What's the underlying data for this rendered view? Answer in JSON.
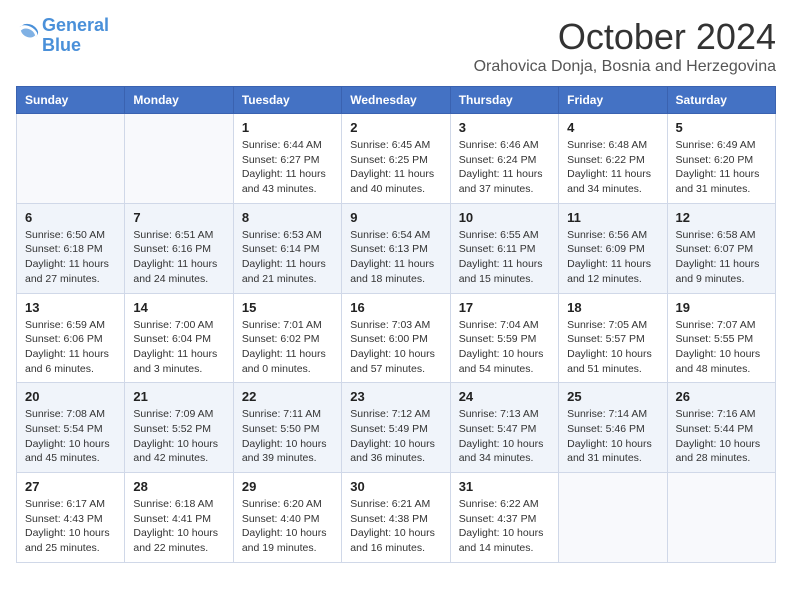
{
  "logo": {
    "line1": "General",
    "line2": "Blue"
  },
  "title": "October 2024",
  "subtitle": "Orahovica Donja, Bosnia and Herzegovina",
  "days_of_week": [
    "Sunday",
    "Monday",
    "Tuesday",
    "Wednesday",
    "Thursday",
    "Friday",
    "Saturday"
  ],
  "weeks": [
    [
      {
        "day": "",
        "sunrise": "",
        "sunset": "",
        "daylight": ""
      },
      {
        "day": "",
        "sunrise": "",
        "sunset": "",
        "daylight": ""
      },
      {
        "day": "1",
        "sunrise": "Sunrise: 6:44 AM",
        "sunset": "Sunset: 6:27 PM",
        "daylight": "Daylight: 11 hours and 43 minutes."
      },
      {
        "day": "2",
        "sunrise": "Sunrise: 6:45 AM",
        "sunset": "Sunset: 6:25 PM",
        "daylight": "Daylight: 11 hours and 40 minutes."
      },
      {
        "day": "3",
        "sunrise": "Sunrise: 6:46 AM",
        "sunset": "Sunset: 6:24 PM",
        "daylight": "Daylight: 11 hours and 37 minutes."
      },
      {
        "day": "4",
        "sunrise": "Sunrise: 6:48 AM",
        "sunset": "Sunset: 6:22 PM",
        "daylight": "Daylight: 11 hours and 34 minutes."
      },
      {
        "day": "5",
        "sunrise": "Sunrise: 6:49 AM",
        "sunset": "Sunset: 6:20 PM",
        "daylight": "Daylight: 11 hours and 31 minutes."
      }
    ],
    [
      {
        "day": "6",
        "sunrise": "Sunrise: 6:50 AM",
        "sunset": "Sunset: 6:18 PM",
        "daylight": "Daylight: 11 hours and 27 minutes."
      },
      {
        "day": "7",
        "sunrise": "Sunrise: 6:51 AM",
        "sunset": "Sunset: 6:16 PM",
        "daylight": "Daylight: 11 hours and 24 minutes."
      },
      {
        "day": "8",
        "sunrise": "Sunrise: 6:53 AM",
        "sunset": "Sunset: 6:14 PM",
        "daylight": "Daylight: 11 hours and 21 minutes."
      },
      {
        "day": "9",
        "sunrise": "Sunrise: 6:54 AM",
        "sunset": "Sunset: 6:13 PM",
        "daylight": "Daylight: 11 hours and 18 minutes."
      },
      {
        "day": "10",
        "sunrise": "Sunrise: 6:55 AM",
        "sunset": "Sunset: 6:11 PM",
        "daylight": "Daylight: 11 hours and 15 minutes."
      },
      {
        "day": "11",
        "sunrise": "Sunrise: 6:56 AM",
        "sunset": "Sunset: 6:09 PM",
        "daylight": "Daylight: 11 hours and 12 minutes."
      },
      {
        "day": "12",
        "sunrise": "Sunrise: 6:58 AM",
        "sunset": "Sunset: 6:07 PM",
        "daylight": "Daylight: 11 hours and 9 minutes."
      }
    ],
    [
      {
        "day": "13",
        "sunrise": "Sunrise: 6:59 AM",
        "sunset": "Sunset: 6:06 PM",
        "daylight": "Daylight: 11 hours and 6 minutes."
      },
      {
        "day": "14",
        "sunrise": "Sunrise: 7:00 AM",
        "sunset": "Sunset: 6:04 PM",
        "daylight": "Daylight: 11 hours and 3 minutes."
      },
      {
        "day": "15",
        "sunrise": "Sunrise: 7:01 AM",
        "sunset": "Sunset: 6:02 PM",
        "daylight": "Daylight: 11 hours and 0 minutes."
      },
      {
        "day": "16",
        "sunrise": "Sunrise: 7:03 AM",
        "sunset": "Sunset: 6:00 PM",
        "daylight": "Daylight: 10 hours and 57 minutes."
      },
      {
        "day": "17",
        "sunrise": "Sunrise: 7:04 AM",
        "sunset": "Sunset: 5:59 PM",
        "daylight": "Daylight: 10 hours and 54 minutes."
      },
      {
        "day": "18",
        "sunrise": "Sunrise: 7:05 AM",
        "sunset": "Sunset: 5:57 PM",
        "daylight": "Daylight: 10 hours and 51 minutes."
      },
      {
        "day": "19",
        "sunrise": "Sunrise: 7:07 AM",
        "sunset": "Sunset: 5:55 PM",
        "daylight": "Daylight: 10 hours and 48 minutes."
      }
    ],
    [
      {
        "day": "20",
        "sunrise": "Sunrise: 7:08 AM",
        "sunset": "Sunset: 5:54 PM",
        "daylight": "Daylight: 10 hours and 45 minutes."
      },
      {
        "day": "21",
        "sunrise": "Sunrise: 7:09 AM",
        "sunset": "Sunset: 5:52 PM",
        "daylight": "Daylight: 10 hours and 42 minutes."
      },
      {
        "day": "22",
        "sunrise": "Sunrise: 7:11 AM",
        "sunset": "Sunset: 5:50 PM",
        "daylight": "Daylight: 10 hours and 39 minutes."
      },
      {
        "day": "23",
        "sunrise": "Sunrise: 7:12 AM",
        "sunset": "Sunset: 5:49 PM",
        "daylight": "Daylight: 10 hours and 36 minutes."
      },
      {
        "day": "24",
        "sunrise": "Sunrise: 7:13 AM",
        "sunset": "Sunset: 5:47 PM",
        "daylight": "Daylight: 10 hours and 34 minutes."
      },
      {
        "day": "25",
        "sunrise": "Sunrise: 7:14 AM",
        "sunset": "Sunset: 5:46 PM",
        "daylight": "Daylight: 10 hours and 31 minutes."
      },
      {
        "day": "26",
        "sunrise": "Sunrise: 7:16 AM",
        "sunset": "Sunset: 5:44 PM",
        "daylight": "Daylight: 10 hours and 28 minutes."
      }
    ],
    [
      {
        "day": "27",
        "sunrise": "Sunrise: 6:17 AM",
        "sunset": "Sunset: 4:43 PM",
        "daylight": "Daylight: 10 hours and 25 minutes."
      },
      {
        "day": "28",
        "sunrise": "Sunrise: 6:18 AM",
        "sunset": "Sunset: 4:41 PM",
        "daylight": "Daylight: 10 hours and 22 minutes."
      },
      {
        "day": "29",
        "sunrise": "Sunrise: 6:20 AM",
        "sunset": "Sunset: 4:40 PM",
        "daylight": "Daylight: 10 hours and 19 minutes."
      },
      {
        "day": "30",
        "sunrise": "Sunrise: 6:21 AM",
        "sunset": "Sunset: 4:38 PM",
        "daylight": "Daylight: 10 hours and 16 minutes."
      },
      {
        "day": "31",
        "sunrise": "Sunrise: 6:22 AM",
        "sunset": "Sunset: 4:37 PM",
        "daylight": "Daylight: 10 hours and 14 minutes."
      },
      {
        "day": "",
        "sunrise": "",
        "sunset": "",
        "daylight": ""
      },
      {
        "day": "",
        "sunrise": "",
        "sunset": "",
        "daylight": ""
      }
    ]
  ]
}
